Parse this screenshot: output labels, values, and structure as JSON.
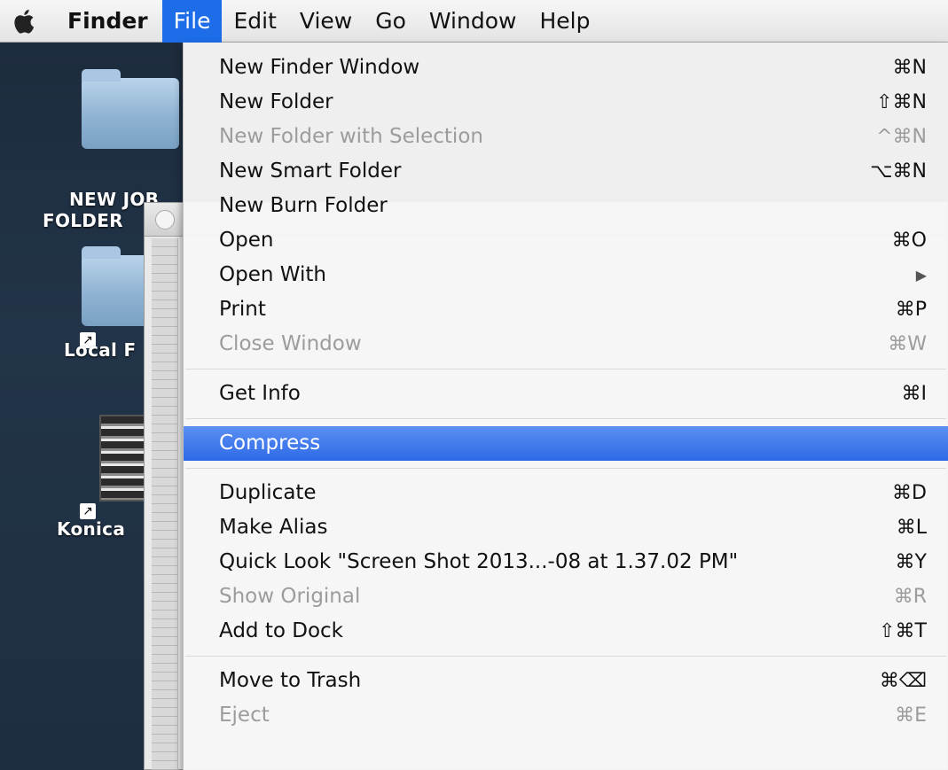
{
  "menubar": {
    "apple_icon": "apple-logo-icon",
    "items": [
      {
        "label": "Finder",
        "kind": "app"
      },
      {
        "label": "File",
        "kind": "active"
      },
      {
        "label": "Edit",
        "kind": "normal"
      },
      {
        "label": "View",
        "kind": "normal"
      },
      {
        "label": "Go",
        "kind": "normal"
      },
      {
        "label": "Window",
        "kind": "normal"
      },
      {
        "label": "Help",
        "kind": "normal"
      }
    ]
  },
  "desktop": {
    "icons": [
      {
        "label_lines": [
          "NEW JOB",
          "FOLDER"
        ],
        "type": "folder-icon"
      },
      {
        "label_lines": [
          "Local F"
        ],
        "type": "folder-alias-icon"
      },
      {
        "label_lines": [
          "Konica"
        ],
        "type": "printer-alias-icon"
      }
    ]
  },
  "file_menu": {
    "items": [
      {
        "type": "item",
        "label": "New Finder Window",
        "shortcut": "⌘N",
        "disabled": false
      },
      {
        "type": "item",
        "label": "New Folder",
        "shortcut": "⇧⌘N",
        "disabled": false
      },
      {
        "type": "item",
        "label": "New Folder with Selection",
        "shortcut": "^⌘N",
        "disabled": true
      },
      {
        "type": "item",
        "label": "New Smart Folder",
        "shortcut": "⌥⌘N",
        "disabled": false
      },
      {
        "type": "item",
        "label": "New Burn Folder",
        "shortcut": "",
        "disabled": false
      },
      {
        "type": "item",
        "label": "Open",
        "shortcut": "⌘O",
        "disabled": false
      },
      {
        "type": "item",
        "label": "Open With",
        "shortcut": "",
        "submenu": true,
        "disabled": false
      },
      {
        "type": "item",
        "label": "Print",
        "shortcut": "⌘P",
        "disabled": false
      },
      {
        "type": "item",
        "label": "Close Window",
        "shortcut": "⌘W",
        "disabled": true
      },
      {
        "type": "separator"
      },
      {
        "type": "item",
        "label": "Get Info",
        "shortcut": "⌘I",
        "disabled": false
      },
      {
        "type": "separator"
      },
      {
        "type": "item",
        "label": "Compress",
        "shortcut": "",
        "disabled": false,
        "highlighted": true
      },
      {
        "type": "separator"
      },
      {
        "type": "item",
        "label": "Duplicate",
        "shortcut": "⌘D",
        "disabled": false
      },
      {
        "type": "item",
        "label": "Make Alias",
        "shortcut": "⌘L",
        "disabled": false
      },
      {
        "type": "item",
        "label": "Quick Look \"Screen Shot 2013...-08 at 1.37.02 PM\"",
        "shortcut": "⌘Y",
        "disabled": false
      },
      {
        "type": "item",
        "label": "Show Original",
        "shortcut": "⌘R",
        "disabled": true
      },
      {
        "type": "item",
        "label": "Add to Dock",
        "shortcut": "⇧⌘T",
        "disabled": false
      },
      {
        "type": "separator"
      },
      {
        "type": "item",
        "label": "Move to Trash",
        "shortcut": "⌘⌫",
        "disabled": false
      },
      {
        "type": "item",
        "label": "Eject",
        "shortcut": "⌘E",
        "disabled": true
      }
    ]
  },
  "colors": {
    "menubar_active": "#1d6ce8",
    "menu_highlight": "#2d6ae6",
    "disabled_text": "#9c9c9c"
  }
}
